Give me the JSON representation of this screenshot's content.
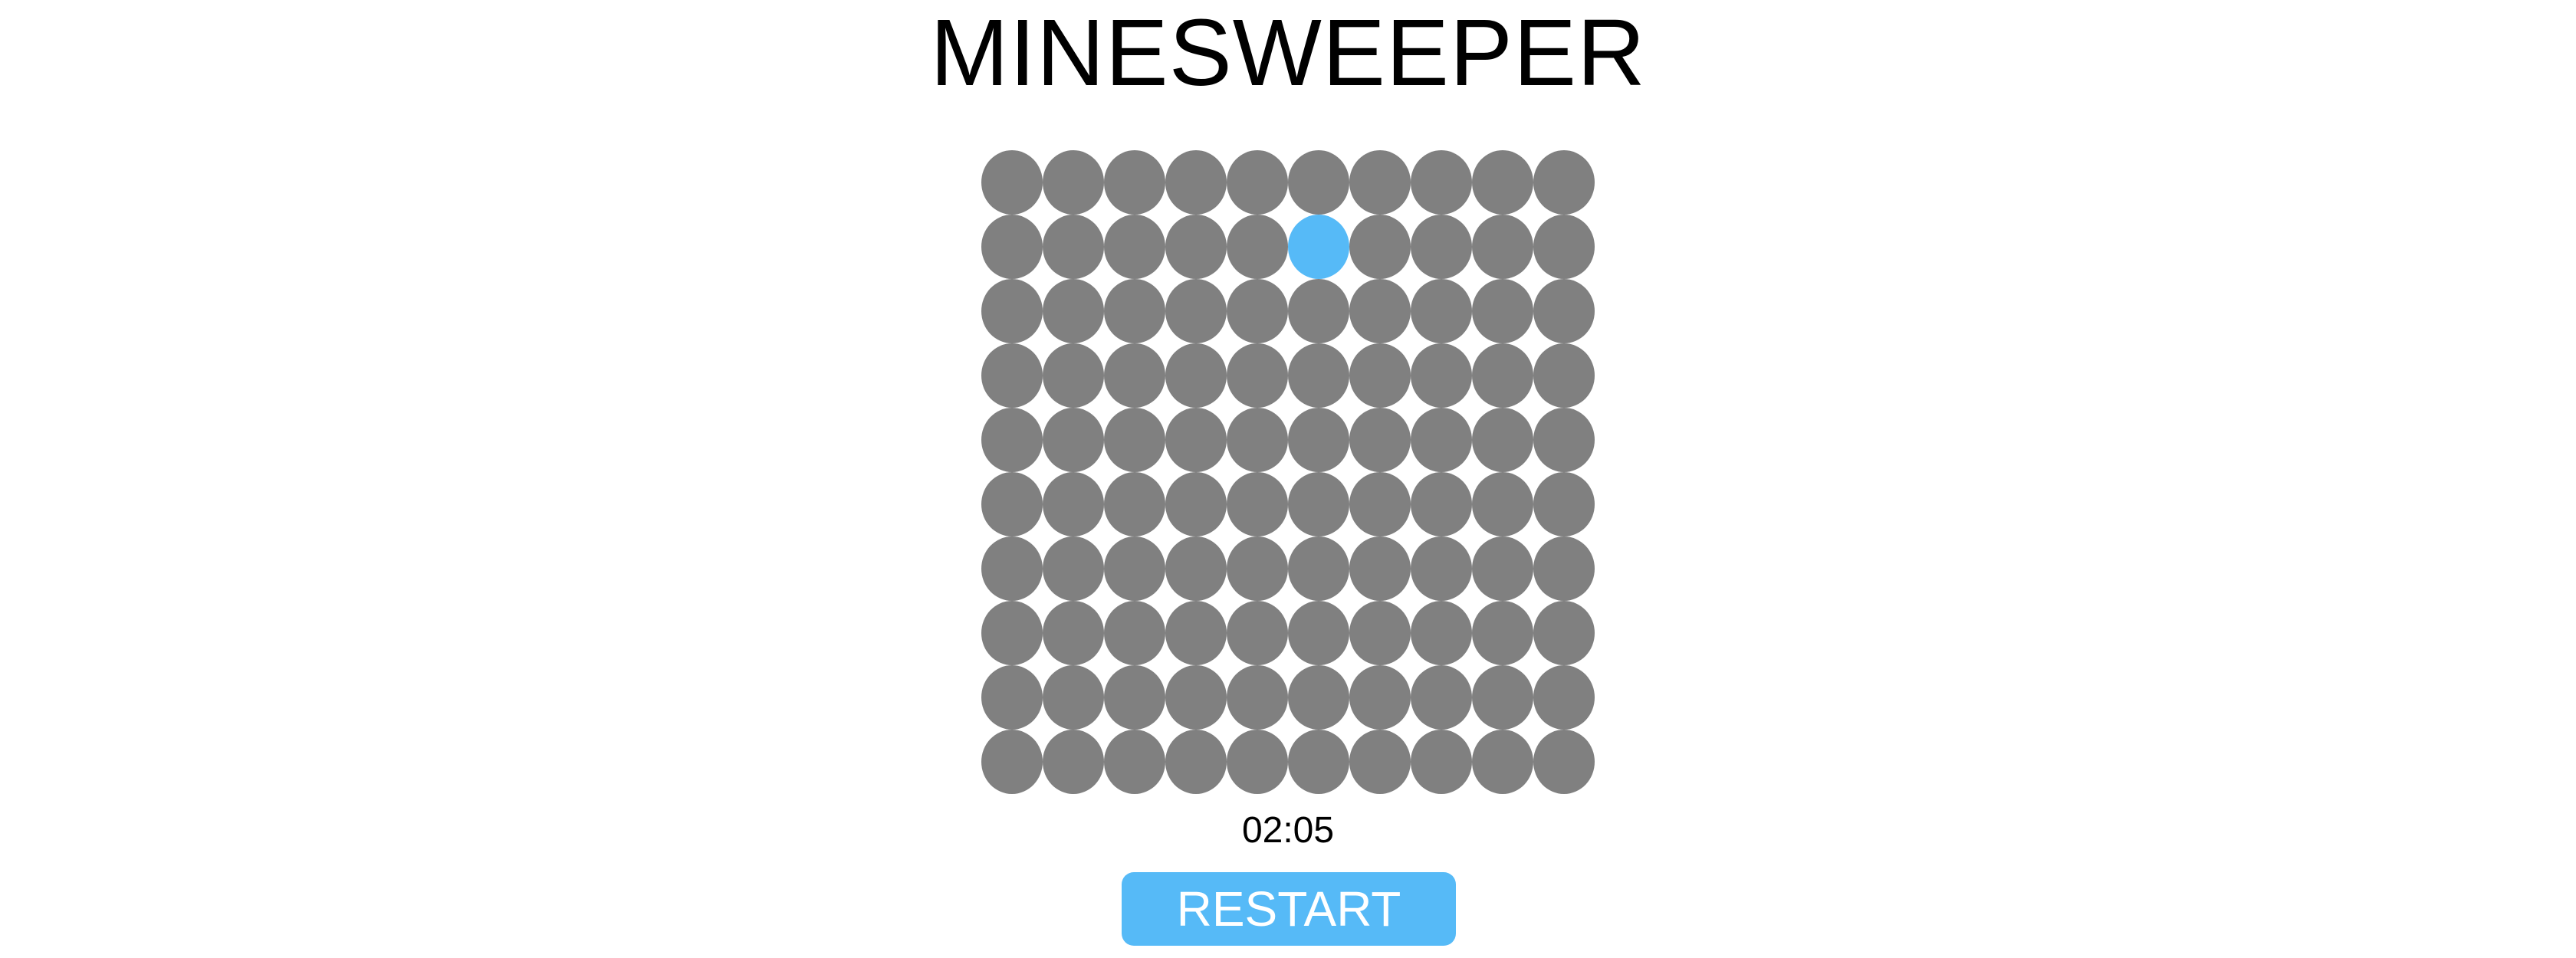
{
  "title": "MINESWEEPER",
  "timer": "02:05",
  "restart_label": "RESTART",
  "board": {
    "rows": 10,
    "cols": 10,
    "selected": {
      "row": 2,
      "col": 6
    }
  },
  "colors": {
    "covered_cell": "#808080",
    "selected_cell": "#56BAF7",
    "button": "#56BAF7"
  }
}
